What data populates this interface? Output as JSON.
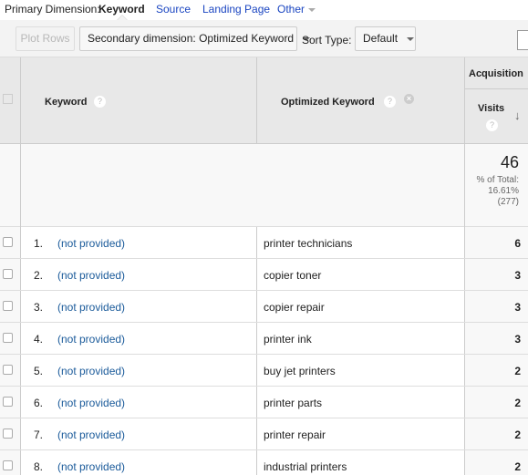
{
  "dimension_bar": {
    "label": "Primary Dimension:",
    "active": "Keyword",
    "links": [
      "Source",
      "Landing Page",
      "Other"
    ]
  },
  "toolbar": {
    "plot_rows": "Plot Rows",
    "secondary_dimension": "Secondary dimension: Optimized Keyword",
    "sort_type_label": "Sort Type:",
    "sort_type_value": "Default"
  },
  "table": {
    "headers": {
      "keyword": "Keyword",
      "optimized_keyword": "Optimized Keyword",
      "group": "Acquisition",
      "visits": "Visits",
      "help_glyph": "?",
      "remove_glyph": "×",
      "sort_glyph": "↓"
    },
    "summary": {
      "total": "46",
      "pct_label": "% of Total:",
      "pct_value": "16.61%",
      "site_total": "(277)"
    },
    "rows": [
      {
        "num": "1.",
        "keyword": "(not provided)",
        "optimized_keyword": "printer technicians",
        "visits": "6"
      },
      {
        "num": "2.",
        "keyword": "(not provided)",
        "optimized_keyword": "copier toner",
        "visits": "3"
      },
      {
        "num": "3.",
        "keyword": "(not provided)",
        "optimized_keyword": "copier repair",
        "visits": "3"
      },
      {
        "num": "4.",
        "keyword": "(not provided)",
        "optimized_keyword": "printer ink",
        "visits": "3"
      },
      {
        "num": "5.",
        "keyword": "(not provided)",
        "optimized_keyword": "buy jet printers",
        "visits": "2"
      },
      {
        "num": "6.",
        "keyword": "(not provided)",
        "optimized_keyword": "printer parts",
        "visits": "2"
      },
      {
        "num": "7.",
        "keyword": "(not provided)",
        "optimized_keyword": "printer repair",
        "visits": "2"
      },
      {
        "num": "8.",
        "keyword": "(not provided)",
        "optimized_keyword": "industrial printers",
        "visits": "2"
      }
    ]
  },
  "colors": {
    "link": "#1a45c1",
    "row_link": "#1a5a9a",
    "header_bg": "#e8e8e8",
    "toolbar_bg": "#f3f3f3"
  }
}
